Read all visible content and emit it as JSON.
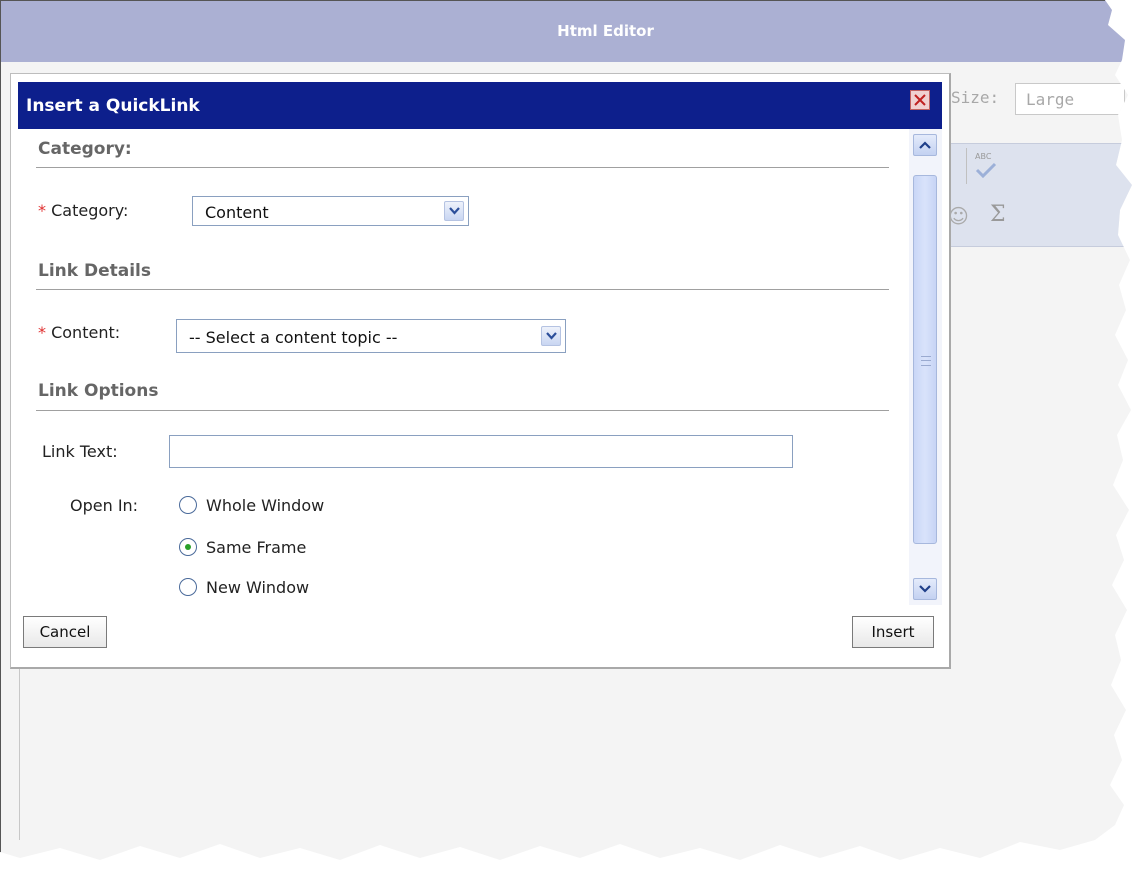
{
  "editor": {
    "title": "Html Editor",
    "size_label": "Size:",
    "size_value": "Large",
    "spell_icon_text": "ABC",
    "sigma_symbol": "Σ"
  },
  "dialog": {
    "title": "Insert a QuickLink",
    "sections": {
      "category": {
        "heading": "Category:",
        "field_label": "Category:",
        "selected_value": "Content"
      },
      "link_details": {
        "heading": "Link Details",
        "field_label": "Content:",
        "selected_value": "-- Select a content topic --"
      },
      "link_options": {
        "heading": "Link Options",
        "link_text_label": "Link Text:",
        "link_text_value": "",
        "open_in_label": "Open In:",
        "open_in_options": [
          {
            "label": "Whole Window",
            "checked": false
          },
          {
            "label": "Same Frame",
            "checked": true
          },
          {
            "label": "New Window",
            "checked": false
          }
        ]
      }
    },
    "required_marker": "*",
    "buttons": {
      "cancel": "Cancel",
      "insert": "Insert"
    }
  },
  "colors": {
    "editor_title_bg": "#abb0d3",
    "dialog_title_bg": "#0d1f8c",
    "required_marker": "#e03030",
    "radio_selected": "#2aa02a"
  }
}
